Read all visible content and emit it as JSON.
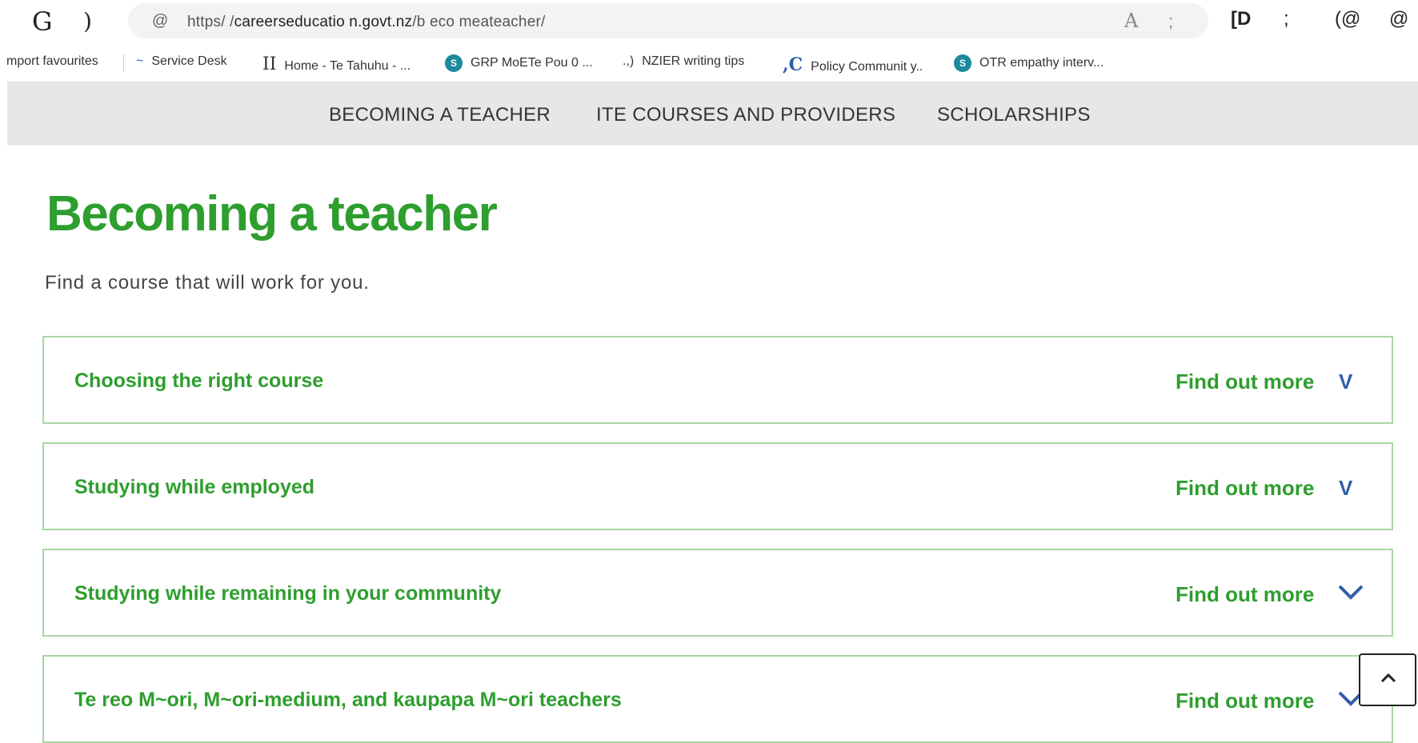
{
  "browser": {
    "back_glyph": "G",
    "refresh_glyph": ")",
    "lock_glyph": "@",
    "url_prefix": "https/ /",
    "url_domain": "careerseducatio n.govt.nz",
    "url_path": "/b eco meateacher/",
    "reader_glyph": "A",
    "star_glyph": ";",
    "toolbar_icons": [
      "[D",
      ";",
      "(@",
      "@"
    ]
  },
  "bookmarks": [
    {
      "icon": "",
      "label": "mport favourites"
    },
    {
      "icon": "~",
      "label": "Service Desk"
    },
    {
      "icon": "II",
      "label": "Home - Te Tahuhu - ..."
    },
    {
      "icon": "S",
      "label": "GRP MoETe Pou 0 ..."
    },
    {
      "icon": ".,)",
      "label": "NZIER writing tips"
    },
    {
      "icon": ",C",
      "label": "Policy Communit y.."
    },
    {
      "icon": "S",
      "label": "OTR empathy interv..."
    }
  ],
  "site_nav": {
    "items": [
      "BECOMING A TEACHER",
      "ITE COURSES AND PROVIDERS",
      "SCHOLARSHIPS"
    ]
  },
  "page": {
    "title": "Becoming a teacher",
    "intro": "Find a course that will work for you."
  },
  "accordion": {
    "items": [
      {
        "title": "Choosing the right course",
        "more": "Find out more",
        "chevron": "V"
      },
      {
        "title": "Studying while employed",
        "more": "Find out more",
        "chevron": "V"
      },
      {
        "title": "Studying while remaining in your community",
        "more": "Find out more",
        "chevron": "chevron-down"
      },
      {
        "title": "Te reo M~ori, M~ori-medium, and kaupapa M~ori teachers",
        "more": "Find out more",
        "chevron": "chevron-down"
      }
    ]
  },
  "colors": {
    "brand_green": "#2e9e2e",
    "chevron_blue": "#2f5fa8",
    "nav_bg": "#e6e7e8"
  }
}
